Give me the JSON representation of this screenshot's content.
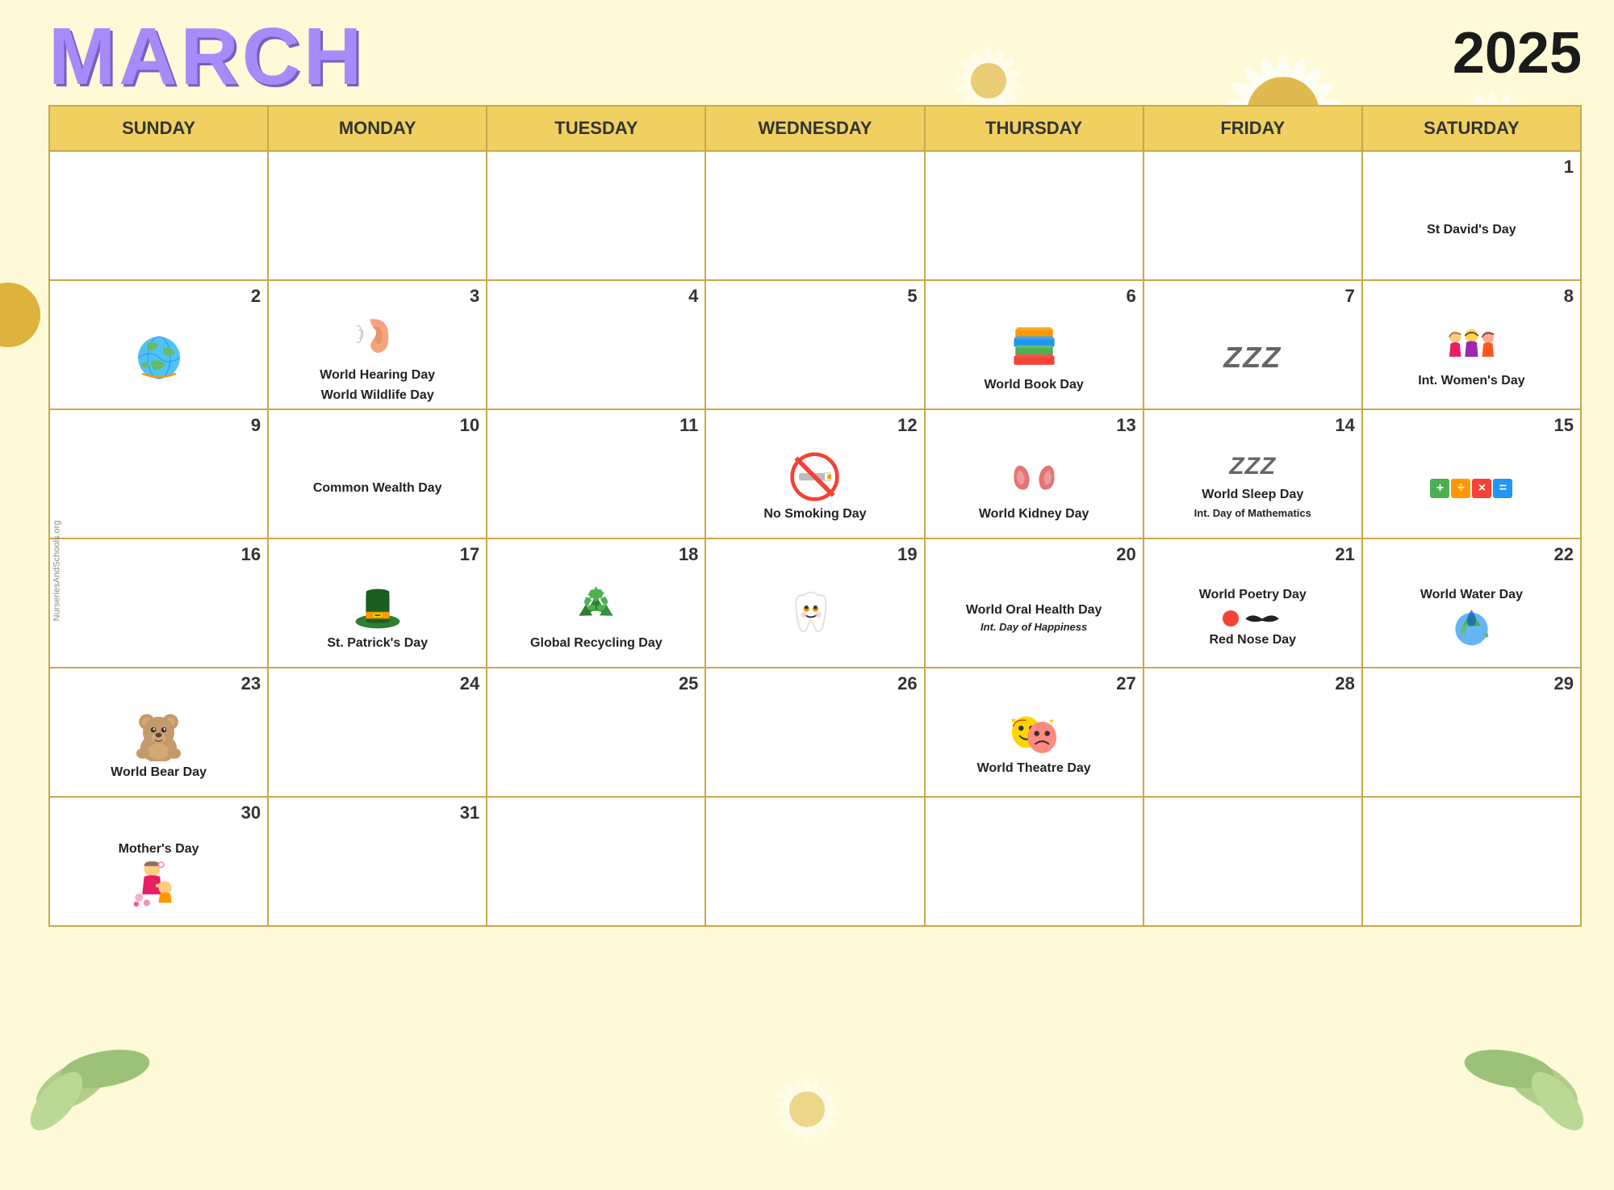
{
  "header": {
    "month": "MARCH",
    "year": "2025"
  },
  "days_of_week": [
    "SUNDAY",
    "MONDAY",
    "TUESDAY",
    "WEDNESDAY",
    "THURSDAY",
    "FRIDAY",
    "SATURDAY"
  ],
  "watermark": "NurseriesAndSchools.org",
  "weeks": [
    [
      {
        "day": "",
        "events": []
      },
      {
        "day": "",
        "events": [],
        "icon": "ear"
      },
      {
        "day": "",
        "events": []
      },
      {
        "day": "",
        "events": []
      },
      {
        "day": "",
        "events": [],
        "icon": "books"
      },
      {
        "day": "",
        "events": []
      },
      {
        "day": "1",
        "events": [
          "St David's Day"
        ]
      }
    ],
    [
      {
        "day": "2",
        "events": [],
        "icon": "earth"
      },
      {
        "day": "3",
        "events": [
          "World Hearing Day",
          "World Wildlife Day"
        ],
        "icon": "ear"
      },
      {
        "day": "4",
        "events": []
      },
      {
        "day": "5",
        "events": []
      },
      {
        "day": "6",
        "events": [
          "World Book Day"
        ],
        "icon": "books"
      },
      {
        "day": "7",
        "events": [],
        "icon": "zzz"
      },
      {
        "day": "8",
        "events": [
          "Int. Women's Day"
        ],
        "icon": "women"
      }
    ],
    [
      {
        "day": "9",
        "events": []
      },
      {
        "day": "10",
        "events": [
          "Common Wealth Day"
        ]
      },
      {
        "day": "11",
        "events": []
      },
      {
        "day": "12",
        "events": [
          "No Smoking Day"
        ],
        "icon": "nosmoking"
      },
      {
        "day": "13",
        "events": [
          "World Kidney Day"
        ],
        "icon": "kidney"
      },
      {
        "day": "14",
        "events": [
          "World Sleep Day",
          "Int. Day of Mathematics"
        ],
        "icon": "zzz_math"
      },
      {
        "day": "15",
        "events": [],
        "icon": "mathicons"
      }
    ],
    [
      {
        "day": "16",
        "events": [],
        "icon": "bear_small"
      },
      {
        "day": "17",
        "events": [
          "St. Patrick's Day"
        ],
        "icon": "hat"
      },
      {
        "day": "18",
        "events": [
          "Global Recycling Day"
        ],
        "icon": "recycle"
      },
      {
        "day": "19",
        "events": [],
        "icon": "tooth"
      },
      {
        "day": "20",
        "events": [
          "World Oral Health Day",
          "Int. Day of Happiness"
        ],
        "icon": "tooth_small"
      },
      {
        "day": "21",
        "events": [
          "World Poetry Day",
          "Red Nose Day"
        ],
        "icon": "rednose"
      },
      {
        "day": "22",
        "events": [
          "World Water Day"
        ],
        "icon": "water"
      }
    ],
    [
      {
        "day": "23",
        "events": [
          "World Bear Day"
        ],
        "icon": "bear"
      },
      {
        "day": "24",
        "events": []
      },
      {
        "day": "25",
        "events": []
      },
      {
        "day": "26",
        "events": []
      },
      {
        "day": "27",
        "events": [
          "World Theatre Day"
        ],
        "icon": "theatre"
      },
      {
        "day": "28",
        "events": []
      },
      {
        "day": "29",
        "events": []
      }
    ],
    [
      {
        "day": "30",
        "events": [
          "Mother's Day"
        ],
        "icon": "mother"
      },
      {
        "day": "31",
        "events": []
      },
      {
        "day": "",
        "events": []
      },
      {
        "day": "",
        "events": []
      },
      {
        "day": "",
        "events": []
      },
      {
        "day": "",
        "events": []
      },
      {
        "day": "",
        "events": []
      }
    ]
  ]
}
